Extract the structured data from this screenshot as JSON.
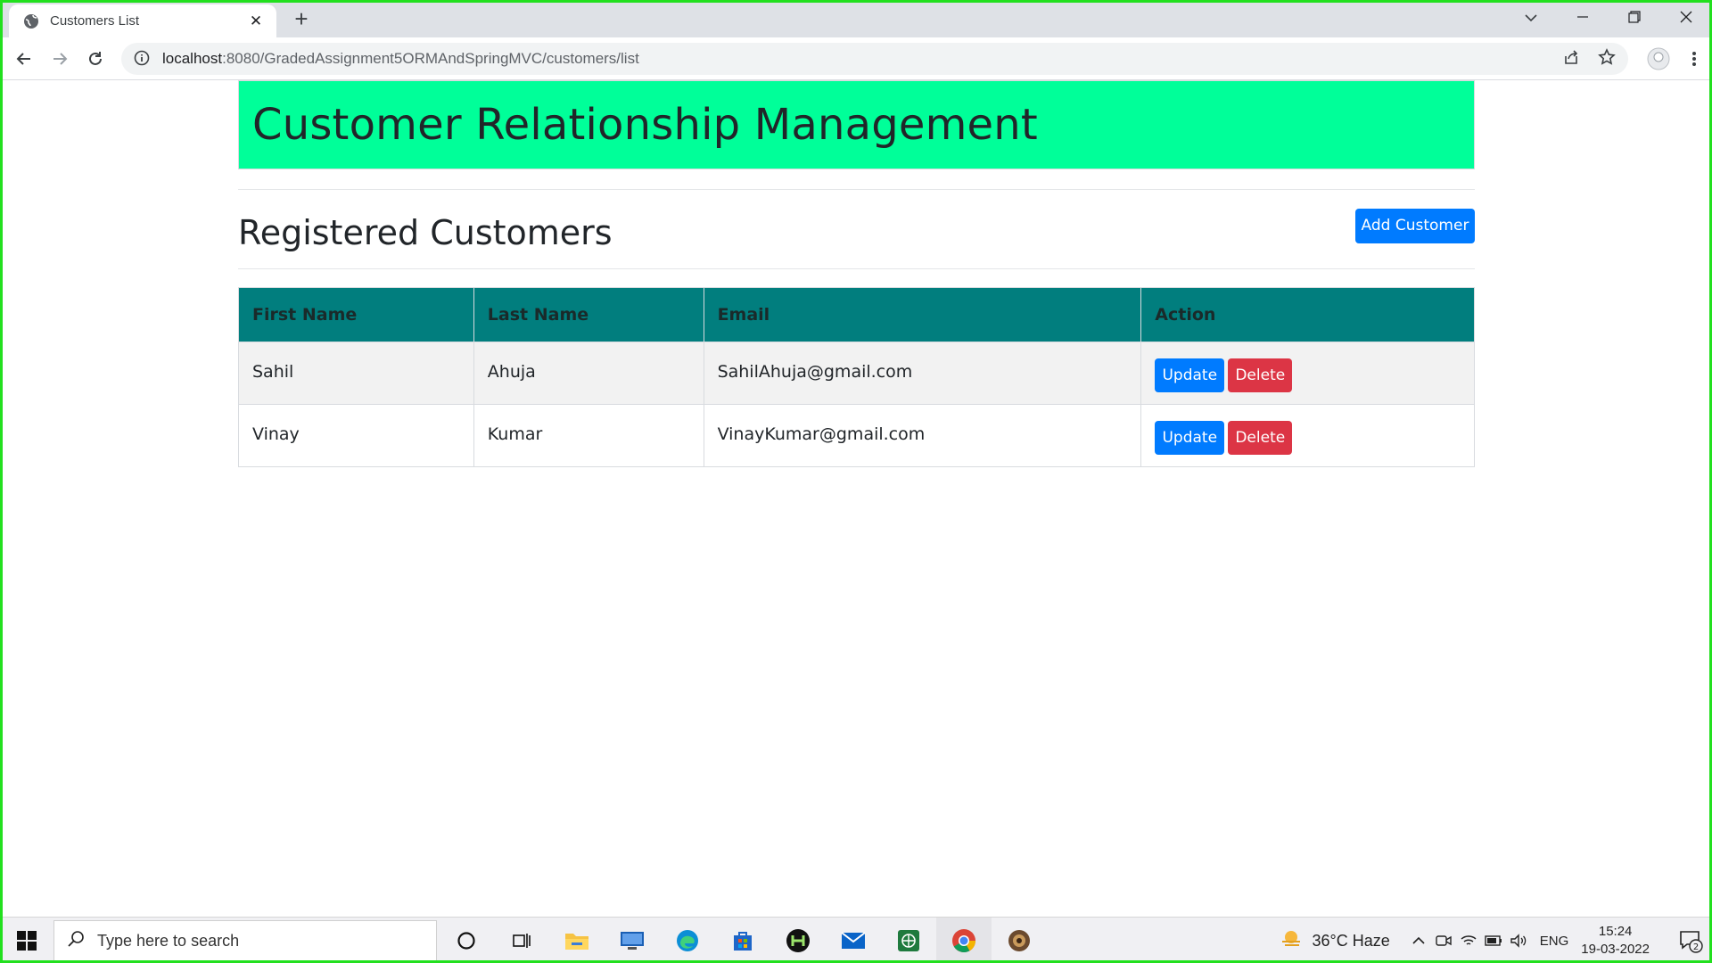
{
  "browser": {
    "tab_title": "Customers List",
    "url_host": "localhost",
    "url_path": ":8080/GradedAssignment5ORMAndSpringMVC/customers/list"
  },
  "page": {
    "banner_title": "Customer Relationship Management",
    "section_title": "Registered Customers",
    "add_button_label": "Add Customer",
    "table": {
      "columns": [
        "First Name",
        "Last Name",
        "Email",
        "Action"
      ],
      "rows": [
        {
          "first_name": "Sahil",
          "last_name": "Ahuja",
          "email": "SahilAhuja@gmail.com",
          "update_label": "Update",
          "delete_label": "Delete"
        },
        {
          "first_name": "Vinay",
          "last_name": "Kumar",
          "email": "VinayKumar@gmail.com",
          "update_label": "Update",
          "delete_label": "Delete"
        }
      ]
    }
  },
  "colors": {
    "banner_bg": "#00ff99",
    "table_header_bg": "#017e7e",
    "primary_button": "#007bff",
    "danger_button": "#dc3545"
  },
  "taskbar": {
    "search_placeholder": "Type here to search",
    "weather_text": "36°C  Haze",
    "language": "ENG",
    "time": "15:24",
    "date": "19-03-2022",
    "notification_count": "2"
  }
}
